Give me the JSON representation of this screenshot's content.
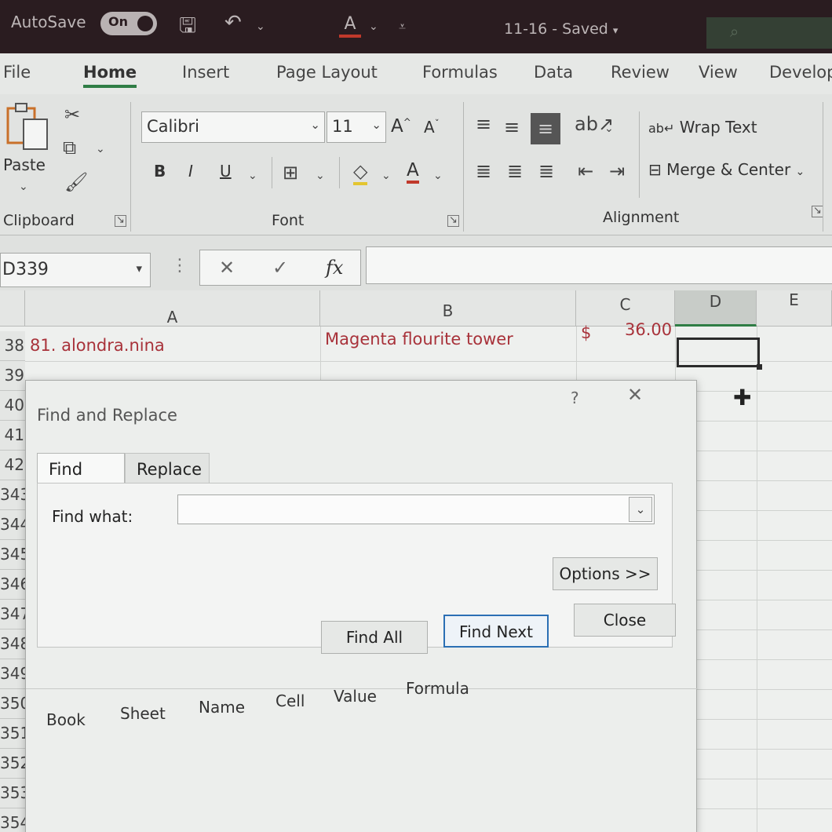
{
  "titlebar": {
    "autosave_label": "AutoSave",
    "autosave_state": "On",
    "doc_title": "11-16 - Saved",
    "font_color_letter": "A"
  },
  "ribbon_tabs": [
    "File",
    "Home",
    "Insert",
    "Page Layout",
    "Formulas",
    "Data",
    "Review",
    "View",
    "Develope"
  ],
  "active_tab": "Home",
  "clipboard": {
    "paste_label": "Paste",
    "group_label": "Clipboard"
  },
  "font": {
    "name": "Calibri",
    "size": "11",
    "bold": "B",
    "italic": "I",
    "underline": "U",
    "color_letter": "A",
    "grow": "A",
    "shrink": "A",
    "group_label": "Font"
  },
  "alignment": {
    "wrap_text": "Wrap Text",
    "merge_center": "Merge & Center",
    "group_label": "Alignment"
  },
  "formula_bar": {
    "name_box": "D339",
    "fx": "fx",
    "formula": ""
  },
  "grid": {
    "columns": [
      "A",
      "B",
      "C",
      "D",
      "E"
    ],
    "selected_column": "D",
    "rows": [
      "38",
      "39",
      "40",
      "41",
      "42",
      "343",
      "344",
      "345",
      "346",
      "347",
      "348",
      "349",
      "350",
      "351",
      "352",
      "353",
      "354"
    ],
    "row_338": {
      "a": "81. alondra.nina",
      "b": "Magenta flourite tower",
      "c_currency": "$",
      "c_value": "36.00"
    }
  },
  "dialog": {
    "title": "Find and Replace",
    "help": "?",
    "close_x": "✕",
    "tabs": [
      "Find",
      "Replace"
    ],
    "active_tab": "Find",
    "find_what_label": "Find what:",
    "find_what_value": "",
    "options_button": "Options >>",
    "find_all_button": "Find All",
    "find_next_button": "Find Next",
    "close_button": "Close",
    "result_columns": [
      "Book",
      "Sheet",
      "Name",
      "Cell",
      "Value",
      "Formula"
    ]
  },
  "colors": {
    "titlebar_bg": "#2a1c20",
    "accent_green": "#2f7d45",
    "cell_text_red": "#a8323a",
    "focus_blue": "#2b6fb4"
  }
}
